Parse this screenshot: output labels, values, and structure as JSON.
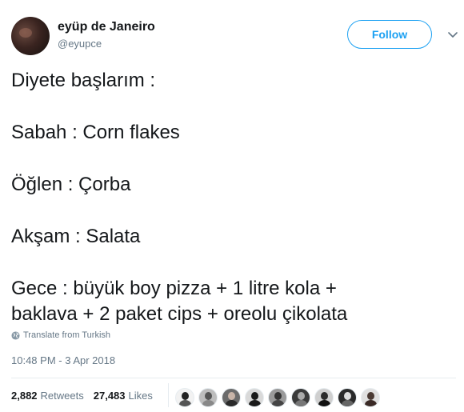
{
  "user": {
    "display_name": "eyüp de Janeiro",
    "handle": "@eyupce"
  },
  "follow_button": {
    "label": "Follow"
  },
  "tweet": {
    "lines": [
      "Diyete başlarım :",
      "Sabah : Corn flakes",
      "Öğlen : Çorba",
      "Akşam : Salata",
      "Gece : büyük boy pizza + 1 litre kola +",
      "baklava + 2 paket cips + oreolu çikolata"
    ],
    "translate_label": "Translate from Turkish",
    "timestamp": "10:48 PM - 3 Apr 2018"
  },
  "stats": {
    "retweets_count": "2,882",
    "retweets_label": "Retweets",
    "likes_count": "27,483",
    "likes_label": "Likes"
  },
  "colors": {
    "accent": "#1da1f2",
    "secondary_text": "#657786",
    "divider": "#e6ecf0"
  },
  "icons": {
    "follow_menu": "chevron-down-icon",
    "translate": "globe-icon"
  }
}
